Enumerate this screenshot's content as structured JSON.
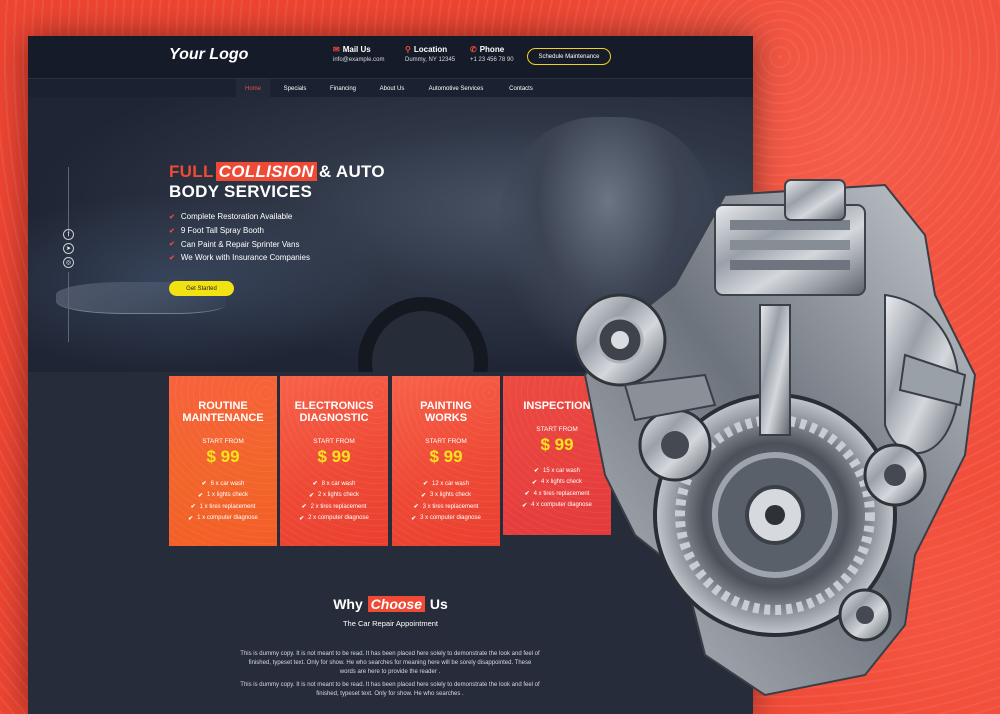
{
  "header": {
    "logo": "Your Logo",
    "contacts": [
      {
        "icon": "envelope-icon",
        "title": "Mail Us",
        "value": "info@example.com"
      },
      {
        "icon": "map-pin-icon",
        "title": "Location",
        "value": "Dummy, NY 12345"
      },
      {
        "icon": "phone-icon",
        "title": "Phone",
        "value": "+1 23 456 78 90"
      }
    ],
    "schedule_button": "Schedule Maintenance"
  },
  "nav": {
    "items": [
      "Home",
      "Specials",
      "Financing",
      "About Us",
      "Automotive Services",
      "Contacts"
    ],
    "active": "Home"
  },
  "hero": {
    "title_part1": "FULL",
    "title_highlight": "COLLISION",
    "title_part2": "& AUTO",
    "title_line2": "BODY SERVICES",
    "features": [
      "Complete Restoration Available",
      "9 Foot Tall Spray Booth",
      "Can Paint & Repair Sprinter Vans",
      "We Work with Insurance Companies"
    ],
    "cta": "Get Started",
    "social_icons": [
      "facebook-icon",
      "telegram-icon",
      "instagram-icon"
    ]
  },
  "pricing": [
    {
      "title_line1": "ROUTINE",
      "title_line2": "MAINTENANCE",
      "start_label": "START FROM",
      "price": "$ 99",
      "items": [
        "6 x car wash",
        "1 x lights check",
        "1 x tires replacement",
        "1 x computer diagnose"
      ]
    },
    {
      "title_line1": "ELECTRONICS",
      "title_line2": "DIAGNOSTIC",
      "start_label": "START FROM",
      "price": "$ 99",
      "items": [
        "8 x car wash",
        "2 x lights check",
        "2 x tires replacement",
        "2 x computer diagnose"
      ]
    },
    {
      "title_line1": "PAINTING",
      "title_line2": "WORKS",
      "start_label": "START FROM",
      "price": "$ 99",
      "items": [
        "12 x car wash",
        "3 x lights check",
        "3 x tires replacement",
        "3 x computer diagnose"
      ]
    },
    {
      "title_line1": "INSPECTION",
      "title_line2": "",
      "start_label": "START FROM",
      "price": "$ 99",
      "items": [
        "15 x car wash",
        "4 x lights check",
        "4 x tires replacement",
        "4 x computer diagnose"
      ]
    }
  ],
  "why": {
    "title_part1": "Why",
    "title_highlight": "Choose",
    "title_part2": "Us",
    "subtitle": "The Car Repair Appointment",
    "paragraph1": "This is dummy copy. It is not meant to be read. It has been placed here solely to demonstrate the look and feel of finished, typeset text. Only for show. He who searches for meaning here will be sorely disappointed. These words are here to provide the reader .",
    "paragraph2": "This is dummy copy. It is not meant to be read. It has been placed here solely to demonstrate the look and feel of finished, typeset text. Only for show. He who searches ."
  },
  "colors": {
    "accent": "#ef4a36",
    "yellow": "#f2e212",
    "dark_bg": "#262c3a",
    "header_bg": "#151b28"
  }
}
